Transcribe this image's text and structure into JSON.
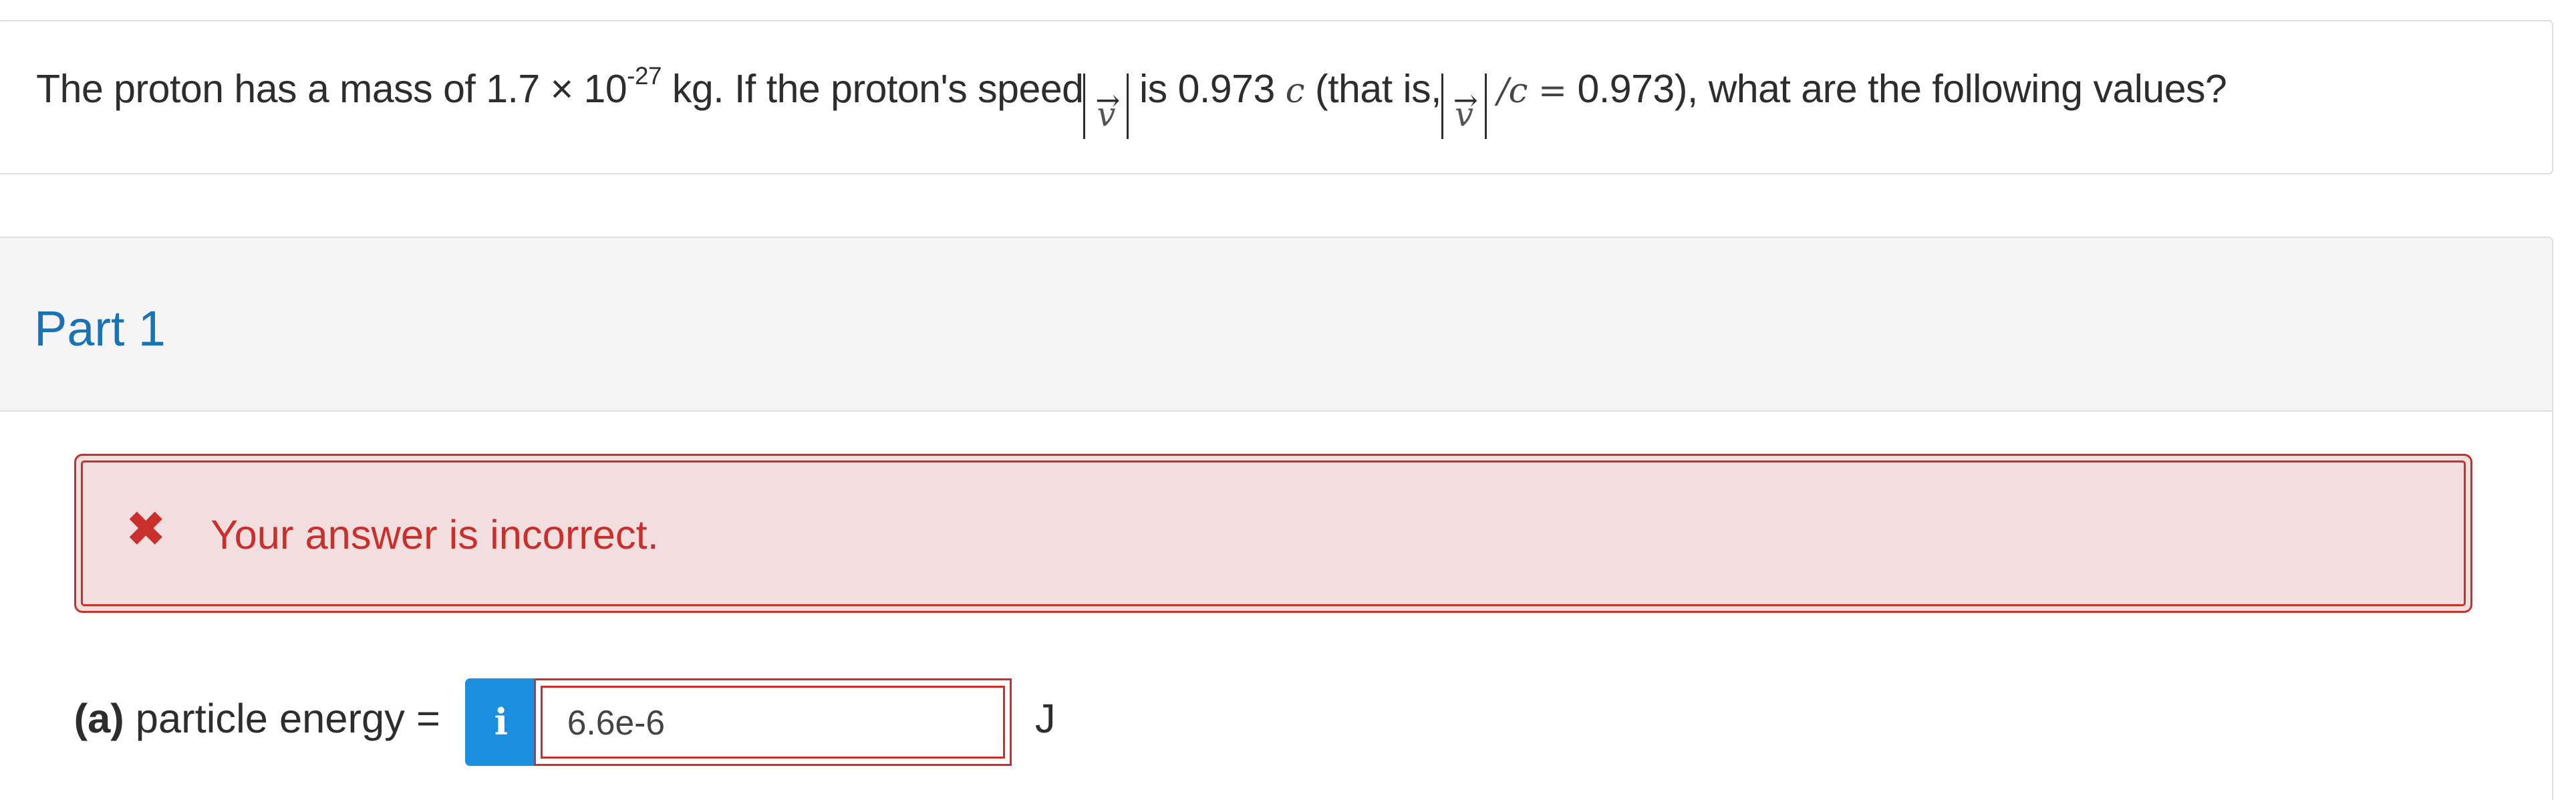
{
  "question": {
    "text_1": "The proton has a mass of 1.7 × 10",
    "exponent": "-27",
    "text_2": " kg. If the proton's speed",
    "vec_symbol": "v",
    "vec_arrow": "→",
    "text_3": " is 0.973 ",
    "c_symbol": "c",
    "text_4": " (that is,",
    "text_5": " /",
    "c_symbol_2": "c",
    "equals": " = ",
    "text_6": " 0.973), what are the following values?"
  },
  "part": {
    "title": "Part 1"
  },
  "feedback": {
    "icon": "close-icon",
    "glyph": "✖",
    "message": "Your answer is incorrect."
  },
  "answer": {
    "label_bold": "(a)",
    "label_rest": " particle energy =",
    "info_glyph": "i",
    "value": "6.6e-6",
    "unit": "J"
  },
  "colors": {
    "accent": "#1a73b5",
    "error": "#c9302c",
    "error_bg": "#f2dede",
    "info_button": "#1a8fe0"
  }
}
